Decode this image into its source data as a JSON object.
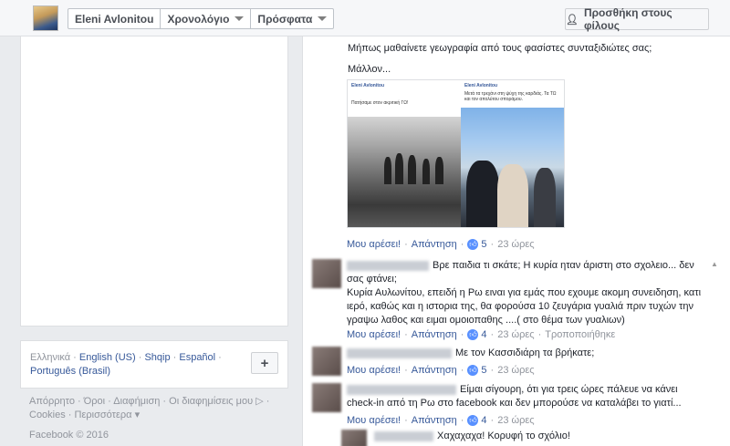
{
  "header": {
    "profile_name": "Eleni Avlonitou",
    "timeline_label": "Χρονολόγιο",
    "recent_label": "Πρόσφατα",
    "add_friend_label": "Προσθήκη στους φίλους"
  },
  "languages": {
    "items": [
      {
        "label": "Ελληνικά",
        "current": true
      },
      {
        "label": "English (US)",
        "current": false
      },
      {
        "label": "Shqip",
        "current": false
      },
      {
        "label": "Español",
        "current": false
      },
      {
        "label": "Português (Brasil)",
        "current": false
      }
    ],
    "add_button_label": "+"
  },
  "footer": {
    "links": [
      "Απόρρητο",
      "Όροι",
      "Διαφήμιση",
      "Οι διαφημίσεις μου",
      "Cookies",
      "Περισσότερα"
    ],
    "copyright": "Facebook © 2016"
  },
  "post": {
    "text_line1": "Μήπως μαθαίνετε γεωγραφία από τους φασίστες συνταξιδιώτες σας;",
    "text_line2": "Μάλλον...",
    "photo_left_name": "Eleni Avlonitou",
    "photo_left_caption": "Πατήσαμε στον ακριτική ΓΩ!",
    "photo_right_name": "Eleni Avlonitou",
    "photo_right_caption": "Μετά τα τρεχάνι στη ψύχη της καρδιάς. Τα ΤΩ και τον απολύτου σποράμου."
  },
  "actions": {
    "like_label": "Μου αρέσει!",
    "reply_label": "Απάντηση",
    "translate_label": "Τροποποιήθηκε"
  },
  "comments": [
    {
      "text": "Βρε παιδια τι σκάτε; Η κυρία ηταν άριστη στο σχολειο... δεν σας φτάνει;\nΚυρία Αυλωνίτου, επειδή η Ρω ειναι για εμάς που εχουμε ακομη συνειδηση, κατι ιερό, καθώς και η ιστορια της, θα φορούσα 10 ζευγάρια γυαλιά πριν τυχών την γραψω λαθος και ειμαι ομοιοπαθης ....( στο θέμα των γυαλιων)",
      "likes": "",
      "time": ""
    },
    {
      "text": "Με τον Κασσιδιάρη τα βρήκατε;",
      "likes": "5",
      "time": "23 ώρες"
    },
    {
      "text": "Είμαι σίγουρη, ότι για τρεις ώρες πάλευε να κάνει check-in από τη Ρω στο facebook και δεν μπορούσε να καταλάβει το γιατί...",
      "likes": "4",
      "time": "23 ώρες"
    },
    {
      "text": "Χαχαχαχα! Κορυφή το σχόλιο!",
      "likes": "",
      "time": ""
    }
  ],
  "post_meta": {
    "likes": "5",
    "time": "23 ώρες"
  }
}
